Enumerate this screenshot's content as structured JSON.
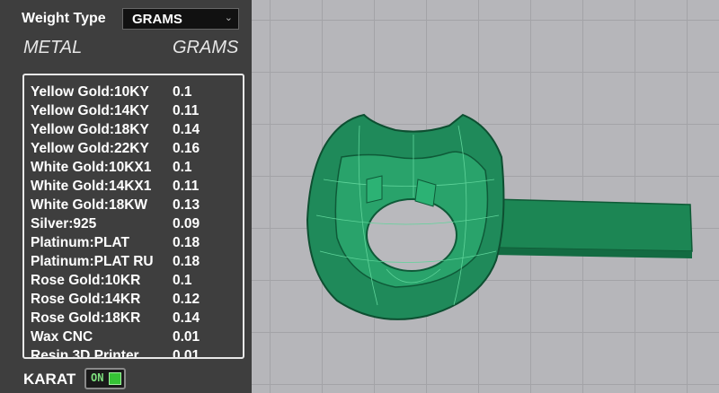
{
  "weight_type": {
    "label": "Weight Type",
    "selected": "GRAMS"
  },
  "table": {
    "col_metal": "METAL",
    "col_grams": "GRAMS",
    "rows": [
      {
        "metal": "Yellow Gold:10KY",
        "grams": "0.1"
      },
      {
        "metal": "Yellow Gold:14KY",
        "grams": "0.11"
      },
      {
        "metal": "Yellow Gold:18KY",
        "grams": "0.14"
      },
      {
        "metal": "Yellow Gold:22KY",
        "grams": "0.16"
      },
      {
        "metal": "White Gold:10KX1",
        "grams": "0.1"
      },
      {
        "metal": "White Gold:14KX1",
        "grams": "0.11"
      },
      {
        "metal": "White Gold:18KW",
        "grams": "0.13"
      },
      {
        "metal": "Silver:925",
        "grams": "0.09"
      },
      {
        "metal": "Platinum:PLAT",
        "grams": "0.18"
      },
      {
        "metal": "Platinum:PLAT RU",
        "grams": "0.18"
      },
      {
        "metal": "Rose Gold:10KR",
        "grams": "0.1"
      },
      {
        "metal": "Rose Gold:14KR",
        "grams": "0.12"
      },
      {
        "metal": "Rose Gold:18KR",
        "grams": "0.14"
      },
      {
        "metal": "Wax  CNC",
        "grams": "0.01"
      },
      {
        "metal": "Resin 3D Printer",
        "grams": "0.01"
      }
    ]
  },
  "karat": {
    "label": "KARAT",
    "toggle_text": "ON",
    "on": true
  },
  "colors": {
    "panel": "#3e3e3e",
    "model": "#1f8a5a",
    "viewport": "#b6b6ba"
  }
}
